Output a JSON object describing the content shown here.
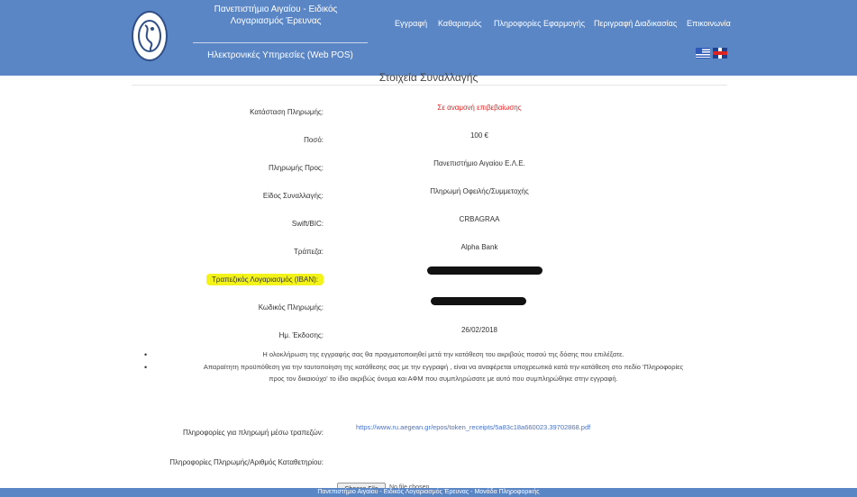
{
  "header": {
    "institution_title": "Πανεπιστήμιο Αιγαίου - Ειδικός Λογαριασμός Έρευνας",
    "subtitle": "Ηλεκτρονικές Υπηρεσίες (Web POS)",
    "nav": [
      "Εγγραφή",
      "Καθαρισμός",
      "Πληροφορίες Εφαρμογής",
      "Περιγραφή Διαδικασίας",
      "Επικοινωνία"
    ]
  },
  "transaction": {
    "section_title": "Στοιχεία Συναλλαγής",
    "rows": [
      {
        "label": "Κατάσταση Πληρωμής:",
        "value": "Σε αναμονή επιβεβαίωσης"
      },
      {
        "label": "Ποσό:",
        "value": "100 €"
      },
      {
        "label": "Πληρωμής Προς:",
        "value": "Πανεπιστήμιο Αιγαίου Ε.Λ.Ε."
      },
      {
        "label": "Είδος Συναλλαγής:",
        "value": "Πληρωμή Οφειλής/Συμμετοχής"
      },
      {
        "label": "Swift/BIC:",
        "value": "CRBAGRAA"
      },
      {
        "label": "Τράπεζα:",
        "value": "Alpha Bank"
      },
      {
        "label": "Τραπεζικός Λογαριασμός (IBAN):",
        "value": ""
      },
      {
        "label": "Κωδικός Πληρωμής:",
        "value": ""
      },
      {
        "label": "Ημ. Έκδοσης:",
        "value": "26/02/2018"
      }
    ]
  },
  "notes": [
    "Η ολοκλήρωση της εγγραφής σας θα πραγματοποιηθεί μετά την κατάθεση του ακριβούς ποσού της δόσης που επιλέξατε.",
    "Απαραίτητη προϋπόθεση για την ταυτοποίηση της κατάθεσης σας με την εγγραφή , είναι να αναφέρεται υποχρεωτικά κατά την κατάθεση στο πεδίο 'Πληροφορίες προς τον δικαιούχο' το ίδιο ακριβώς όνομα και ΑΦΜ που συμπληρώσατε με αυτό που συμπληρώθηκε στην εγγραφή."
  ],
  "payment_info": {
    "label": "Πληροφορίες για πληρωμή μέσω τραπεζών:",
    "link": "https://www.ru.aegean.gr/epos/token_receipts/5a83c18a660023.39702868.pdf"
  },
  "deposit_info": {
    "label": "Πληροφορίες Πληρωμής/Αριθμός Καταθετηρίου:",
    "file_button": "Choose File",
    "file_text": "No file chosen"
  },
  "footer": {
    "text": "Πανεπιστήμιο Αιγαίου - Ειδικός Λογαριασμός Έρευνας - Μονάδα Πληροφορικής"
  },
  "colors": {
    "header_bg": "#5b86c6",
    "status_red": "#e02020",
    "highlight": "#f3f31a",
    "link": "#4a72c4"
  },
  "icons": {
    "logo": "university-emblem",
    "lang_gr": "greek-flag",
    "lang_en": "uk-flag"
  }
}
